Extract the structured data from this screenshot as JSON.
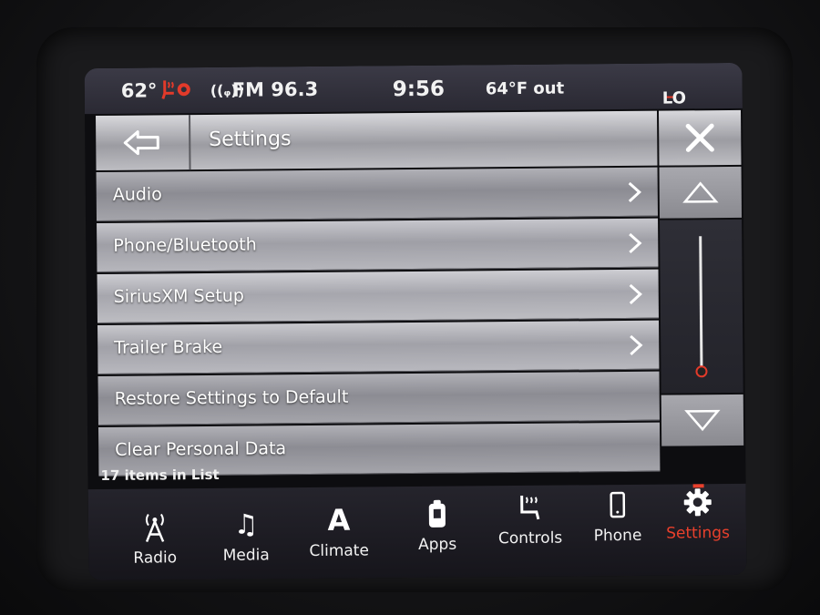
{
  "status": {
    "cabin_temp": "62°",
    "radio": "FM 96.3",
    "time": "9:56",
    "outside_temp": "64°F out",
    "seat_level": "LO"
  },
  "header": {
    "title": "Settings"
  },
  "list": {
    "items": [
      {
        "label": "Audio",
        "has_chevron": true
      },
      {
        "label": "Phone/Bluetooth",
        "has_chevron": true
      },
      {
        "label": "SiriusXM Setup",
        "has_chevron": true
      },
      {
        "label": "Trailer Brake",
        "has_chevron": true
      },
      {
        "label": "Restore Settings to Default",
        "has_chevron": false
      },
      {
        "label": "Clear Personal Data",
        "has_chevron": false
      }
    ],
    "count_text": "17 items in List"
  },
  "nav": {
    "items": [
      {
        "label": "Radio",
        "icon": "radio-tower-icon"
      },
      {
        "label": "Media",
        "icon": "music-note-icon"
      },
      {
        "label": "Climate",
        "icon": "climate-a-icon"
      },
      {
        "label": "Apps",
        "icon": "apps-icon"
      },
      {
        "label": "Controls",
        "icon": "seat-controls-icon"
      },
      {
        "label": "Phone",
        "icon": "phone-icon"
      },
      {
        "label": "Settings",
        "icon": "gear-icon"
      }
    ],
    "active": "Settings"
  },
  "colors": {
    "accent": "#e8402c",
    "status_bar": "#2f2e38"
  }
}
